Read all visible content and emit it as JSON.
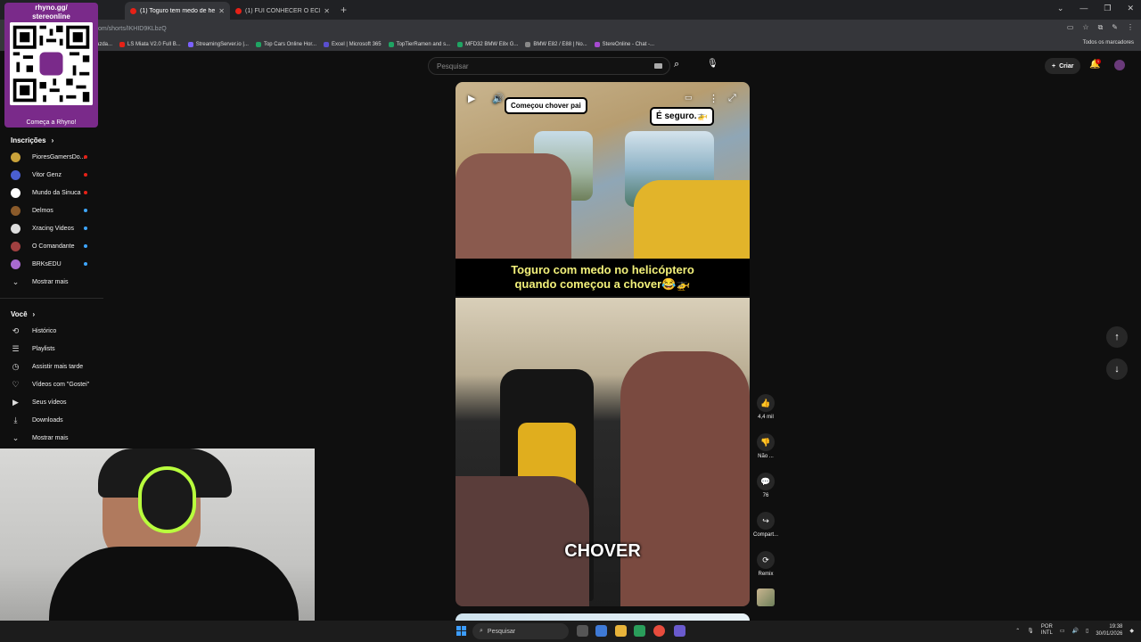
{
  "browser": {
    "tabs": [
      {
        "title": "(1) Toguro tem medo de helicóp",
        "active": true
      },
      {
        "title": "(1) FUI CONHECER O ECLIPSE M",
        "active": false
      }
    ],
    "url": "om/shorts/IKHID9KLbzQ",
    "bookmarks": [
      "azda...",
      "LS Miata V2.0 Full B...",
      "StreamingServer.io |...",
      "Top Cars Online Hor...",
      "Excel | Microsoft 365",
      "TopTierRamen and s...",
      "MFD32 BMW E8x G...",
      "BMW E82 / E88 | No...",
      "StereOnline - Chat -..."
    ],
    "bookmarks_right": "Todos os marcadores",
    "bookmark_colors": [
      "#888888",
      "#e62117",
      "#7b61ff",
      "#1fa463",
      "#5a4fcf",
      "#1fa463",
      "#1fa463",
      "#888888",
      "#a64ad0"
    ]
  },
  "overlay": {
    "qr_title_1": "rhyno.gg/",
    "qr_title_2": "stereonline",
    "qr_cta": "Começa a Rhyno!"
  },
  "youtube": {
    "search_placeholder": "Pesquisar",
    "create_label": "Criar",
    "notification_count": "1"
  },
  "sidebar": {
    "subscriptions_heading": "Inscrições",
    "subscriptions": [
      {
        "name": "PioresGamersDo...",
        "color": "#c9a23a",
        "live": true
      },
      {
        "name": "Vitor Genz",
        "color": "#4a5fd0",
        "live": true
      },
      {
        "name": "Mundo da Sinuca",
        "color": "#ffffff",
        "live": true
      },
      {
        "name": "Delmos",
        "color": "#8a5a2a",
        "live": true
      },
      {
        "name": "Xracing Videos",
        "color": "#dddddd",
        "live": true
      },
      {
        "name": "O Comandante",
        "color": "#a04040",
        "live": true
      },
      {
        "name": "BRKsEDU",
        "color": "#a86ad0",
        "live": true
      }
    ],
    "subscriptions_more": "Mostrar mais",
    "you_heading": "Você",
    "you_items": [
      {
        "label": "Histórico",
        "icon": "history-icon",
        "glyph": "⟲"
      },
      {
        "label": "Playlists",
        "icon": "playlist-icon",
        "glyph": "☰"
      },
      {
        "label": "Assistir mais tarde",
        "icon": "watch-later-icon",
        "glyph": "◷"
      },
      {
        "label": "Vídeos com \"Gostei\"",
        "icon": "like-icon",
        "glyph": "👍"
      },
      {
        "label": "Seus vídeos",
        "icon": "your-videos-icon",
        "glyph": "▶"
      },
      {
        "label": "Downloads",
        "icon": "download-icon",
        "glyph": "⤓"
      }
    ],
    "you_more": "Mostrar mais"
  },
  "short": {
    "bubble_1": "Começou chover pai",
    "bubble_2": "É seguro.🚁",
    "caption_line_1": "Toguro com medo no helicóptero",
    "caption_line_2": "quando começou a chover😂🚁",
    "big_word": "CHOVER"
  },
  "actions": {
    "likes": "4,4 mil",
    "dislike": "Não ...",
    "comments": "76",
    "share": "Compart...",
    "remix": "Remix"
  },
  "taskbar": {
    "search": "Pesquisar",
    "lang_1": "POR",
    "lang_2": "INTL",
    "time": "19:38",
    "date": "30/01/2026"
  }
}
